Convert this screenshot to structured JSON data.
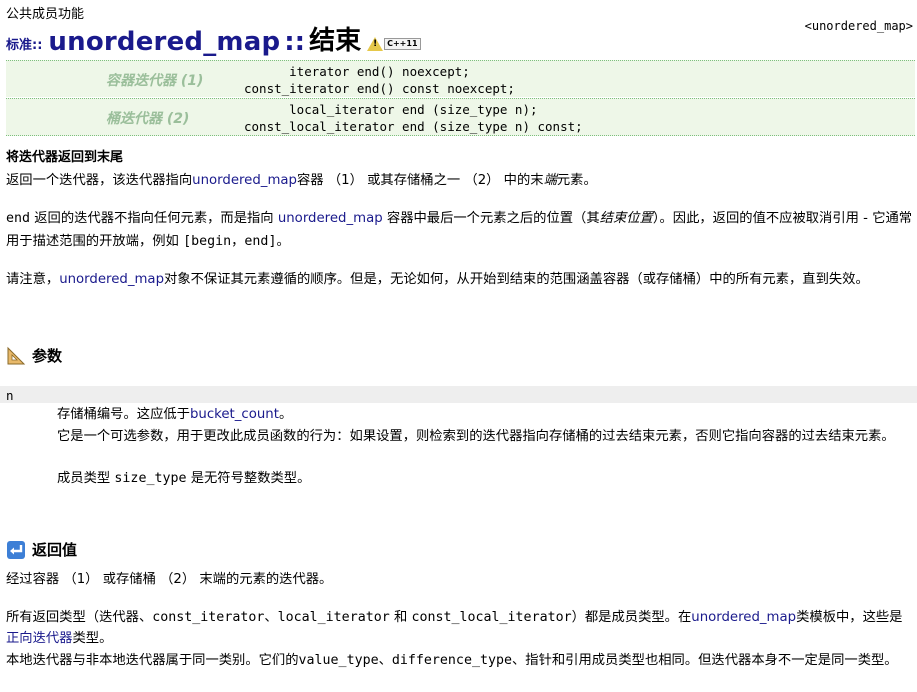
{
  "header": {
    "kicker": "公共成员功能",
    "breadcrumb_right": "<unordered_map>",
    "std_label": "标准::",
    "title_main": "unordered_map",
    "title_sep": "::",
    "title_zh": "结束",
    "badge_text": "C++11"
  },
  "signatures": [
    {
      "label": "容器迭代器 (1)",
      "lines": [
        "      iterator end() noexcept;",
        "const_iterator end() const noexcept;"
      ]
    },
    {
      "label": "桶迭代器 (2)",
      "lines": [
        "      local_iterator end (size_type n);",
        "const_local_iterator end (size_type n) const;"
      ]
    }
  ],
  "summary": {
    "heading": "将迭代器返回到末尾",
    "p1_a": "返回一个迭代器，该迭代器指向",
    "p1_link": "unordered_map",
    "p1_b": "容器 （1） 或其存储桶之一 （2） 中的末",
    "p1_ital": "端",
    "p1_c": "元素。",
    "p2_code": "end",
    "p2_a": " 返回的迭代器不指向任何元素，而是指向 ",
    "p2_link": "unordered_map",
    "p2_b": " 容器中最后一个元素之后的位置（其",
    "p2_ital": "结束位置",
    "p2_c": "）。因此，返回的值不应被取消引用 - 它通常用于描述范围的开放端，例如 ",
    "p2_range": "[begin，end]",
    "p2_d": "。",
    "p3_a": "请注意，",
    "p3_link": "unordered_map",
    "p3_b": "对象不保证其元素遵循的顺序。但是，无论如何，从开始到结束的范围涵盖容器（或存储桶）中的所有元素，直到失效。"
  },
  "params": {
    "heading": "参数",
    "name": "n",
    "d1_a": "存储桶编号。这应低于",
    "d1_link": "bucket_count",
    "d1_b": "。",
    "d2": "它是一个可选参数，用于更改此成员函数的行为：如果设置，则检索到的迭代器指向存储桶的过去结束元素，否则它指向容器的过去结束元素。",
    "d3_a": "成员类型 ",
    "d3_code": "size_type",
    "d3_b": " 是无符号整数类型。"
  },
  "returns": {
    "heading": "返回值",
    "r1": "经过容器 （1） 或存储桶 （2） 末端的元素的迭代器。",
    "r2_a": "所有返回类型（迭代器、",
    "r2_c1": "const_iterator",
    "r2_s1": "、",
    "r2_c2": "local_iterator",
    "r2_s2": " 和 ",
    "r2_c3": "const_local_iterator",
    "r2_b": "）都是成员类型。在",
    "r2_link": "unordered_map",
    "r2_c": "类模板中，这些是",
    "r2_link2": "正向迭代器",
    "r2_d": "类型。",
    "r3_a": "本地迭代器与非本地迭代器属于同一类别。它们的",
    "r3_c1": "value_type",
    "r3_s1": "、",
    "r3_c2": "difference_type",
    "r3_b": "、指针和引用成员类型也相同。但迭代器本身不一定是同一类型。"
  },
  "colors": {
    "link": "#1a1a8c",
    "sig_bg": "#eef7e8",
    "sig_label": "#9bbf9b"
  }
}
